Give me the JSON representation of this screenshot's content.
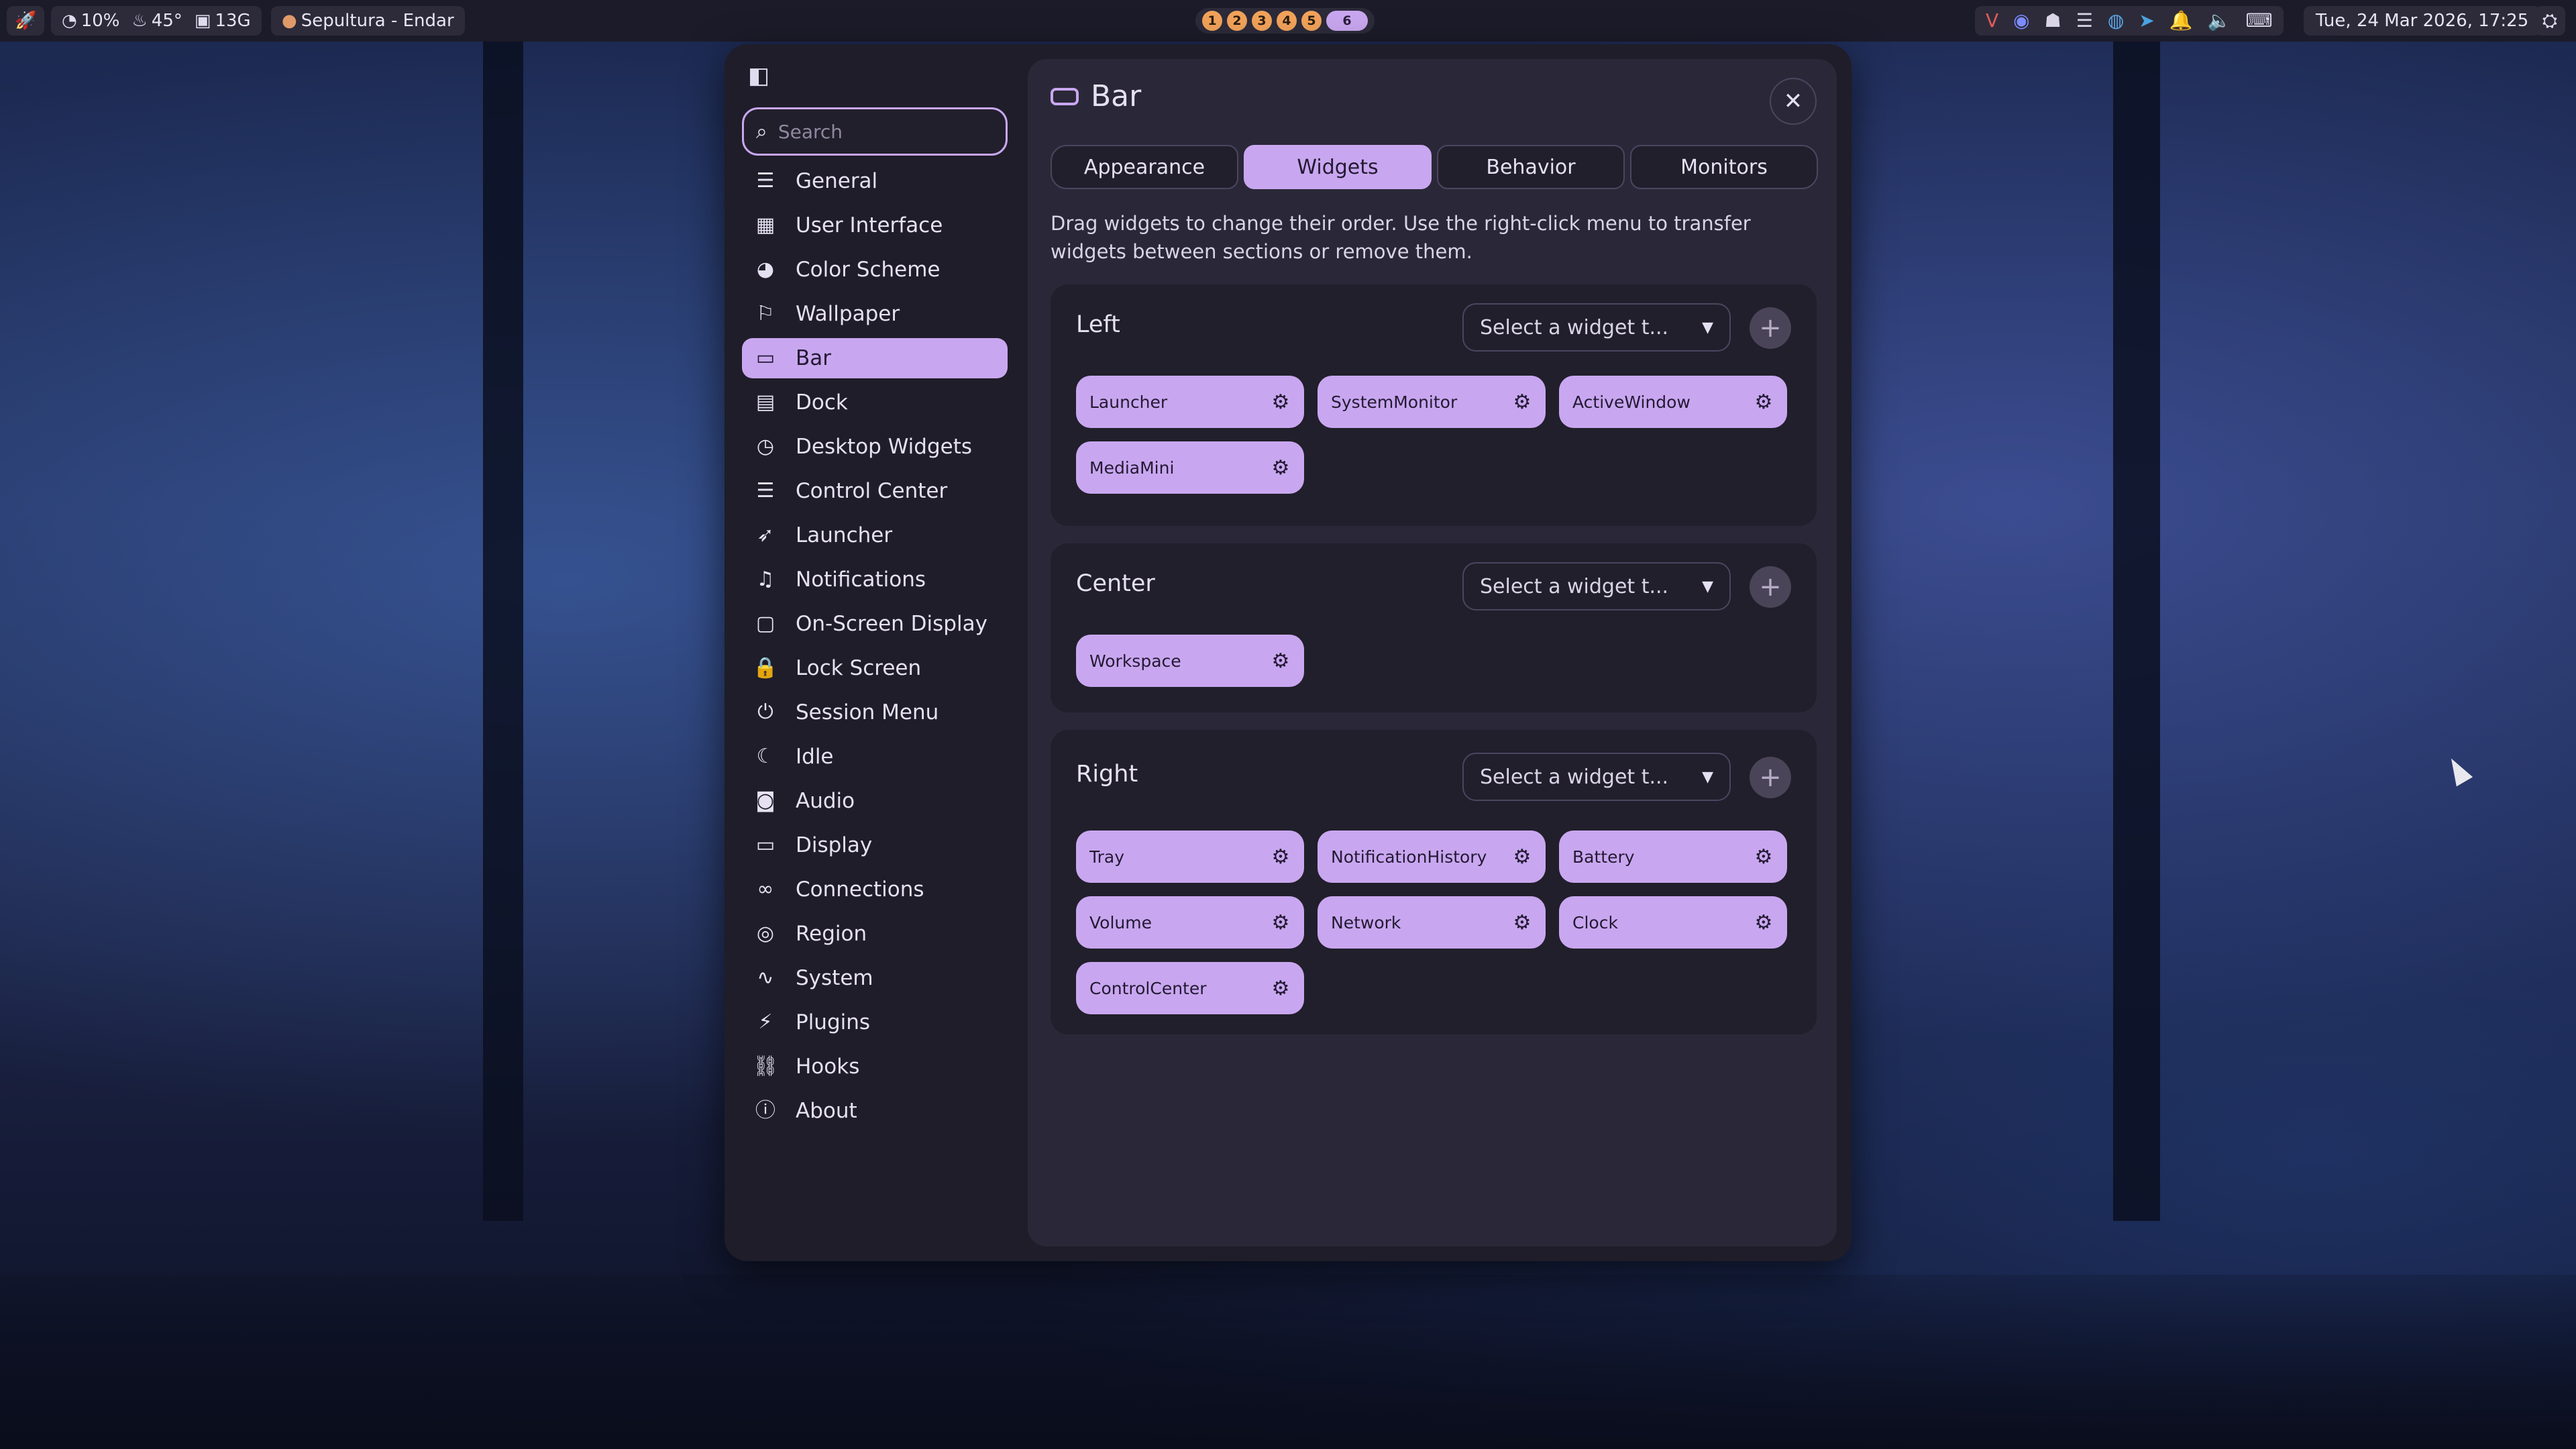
{
  "topbar": {
    "launcher_icon": "rocket-icon",
    "cpu": "10%",
    "temp": "45°",
    "memory": "13G",
    "media": "Sepultura - Endar",
    "workspaces": [
      "1",
      "2",
      "3",
      "4",
      "5",
      "6"
    ],
    "active_workspace": "6",
    "tray_icons": [
      "vk-icon",
      "browser-icon",
      "ghost-icon",
      "spotify-icon",
      "steam-icon",
      "telegram-icon",
      "bell-icon",
      "volume-icon",
      "keyboard-icon"
    ],
    "clock": "Tue, 24 Mar 2026, 17:25"
  },
  "sidebar": {
    "search_placeholder": "Search",
    "items": [
      {
        "label": "General",
        "icon": "sliders-icon"
      },
      {
        "label": "User Interface",
        "icon": "layout-icon"
      },
      {
        "label": "Color Scheme",
        "icon": "palette-icon"
      },
      {
        "label": "Wallpaper",
        "icon": "paint-roller-icon"
      },
      {
        "label": "Bar",
        "icon": "bar-icon"
      },
      {
        "label": "Dock",
        "icon": "dock-icon"
      },
      {
        "label": "Desktop Widgets",
        "icon": "clock-icon"
      },
      {
        "label": "Control Center",
        "icon": "sliders-icon"
      },
      {
        "label": "Launcher",
        "icon": "rocket-icon"
      },
      {
        "label": "Notifications",
        "icon": "bell-icon"
      },
      {
        "label": "On-Screen Display",
        "icon": "osd-icon"
      },
      {
        "label": "Lock Screen",
        "icon": "lock-icon"
      },
      {
        "label": "Session Menu",
        "icon": "power-icon"
      },
      {
        "label": "Idle",
        "icon": "moon-icon"
      },
      {
        "label": "Audio",
        "icon": "speaker-icon"
      },
      {
        "label": "Display",
        "icon": "monitor-icon"
      },
      {
        "label": "Connections",
        "icon": "link-circles-icon"
      },
      {
        "label": "Region",
        "icon": "globe-icon"
      },
      {
        "label": "System",
        "icon": "activity-icon"
      },
      {
        "label": "Plugins",
        "icon": "plug-icon"
      },
      {
        "label": "Hooks",
        "icon": "chain-icon"
      },
      {
        "label": "About",
        "icon": "info-icon"
      }
    ],
    "active": "Bar"
  },
  "panel": {
    "title": "Bar",
    "tabs": [
      "Appearance",
      "Widgets",
      "Behavior",
      "Monitors"
    ],
    "active_tab": "Widgets",
    "description": "Drag widgets to change their order. Use the right-click menu to transfer widgets between sections or remove them.",
    "select_placeholder": "Select a widget t...",
    "sections": {
      "left": {
        "title": "Left",
        "widgets": [
          "Launcher",
          "SystemMonitor",
          "ActiveWindow",
          "MediaMini"
        ]
      },
      "center": {
        "title": "Center",
        "widgets": [
          "Workspace"
        ]
      },
      "right": {
        "title": "Right",
        "widgets": [
          "Tray",
          "NotificationHistory",
          "Battery",
          "Volume",
          "Network",
          "Clock",
          "ControlCenter"
        ]
      }
    }
  },
  "colors": {
    "accent": "#c9a7f0",
    "panel_bg": "#2a2838",
    "window_bg": "#1f1d29",
    "workspace_badge": "#f2a35a"
  }
}
